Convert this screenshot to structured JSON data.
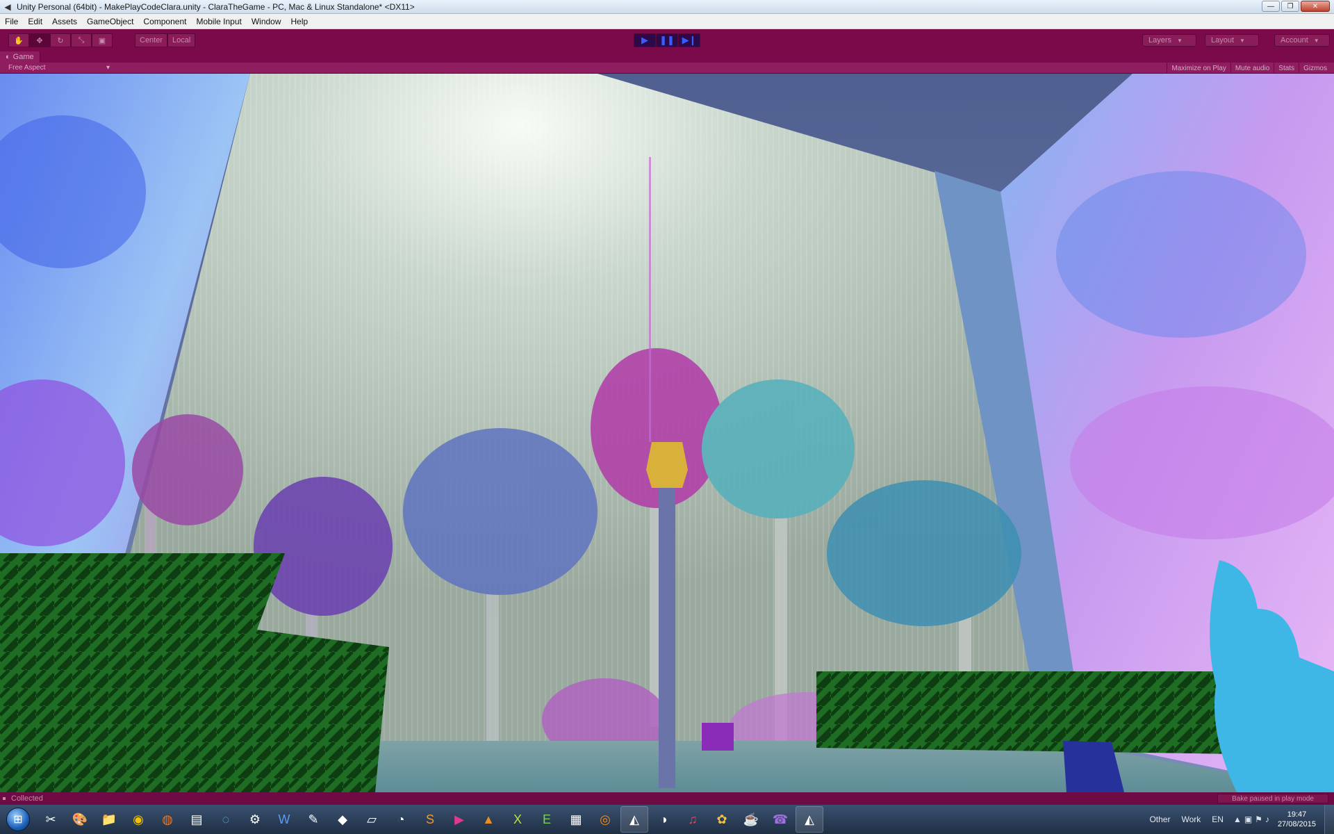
{
  "window": {
    "title": "Unity Personal (64bit) - MakePlayCodeClara.unity - ClaraTheGame - PC, Mac & Linux Standalone* <DX11>",
    "minimize": "—",
    "maximize": "❐",
    "close": "✕"
  },
  "menu": [
    "File",
    "Edit",
    "Assets",
    "GameObject",
    "Component",
    "Mobile Input",
    "Window",
    "Help"
  ],
  "toolbar": {
    "pivot": "Center",
    "space": "Local",
    "layers": "Layers",
    "layout": "Layout",
    "account": "Account"
  },
  "game_view": {
    "tab_label": "Game",
    "aspect": "Free Aspect",
    "maximize_on_play": "Maximize on Play",
    "mute_audio": "Mute audio",
    "stats": "Stats",
    "gizmos": "Gizmos"
  },
  "status": {
    "message": "Collected",
    "bake": "Bake paused in play mode"
  },
  "taskbar": {
    "toolbars": [
      "Other",
      "Work"
    ],
    "language": "EN",
    "time": "19:47",
    "date": "27/08/2015",
    "icons": [
      "scissors-icon",
      "paint-icon",
      "folder-icon",
      "chrome-icon",
      "firefox-icon",
      "terminal-icon",
      "sync-icon",
      "steam-icon",
      "word-icon",
      "editor-icon",
      "inkscape-icon",
      "notes-icon",
      "gimp-icon",
      "sublime-icon",
      "media-icon",
      "vlc-icon",
      "xnview-icon",
      "evernote-icon",
      "pdf-icon",
      "blender-icon",
      "unity-icon",
      "tool-icon",
      "itunes-icon",
      "picasa-icon",
      "genie-icon",
      "viber-icon",
      "unity-active-icon"
    ]
  }
}
